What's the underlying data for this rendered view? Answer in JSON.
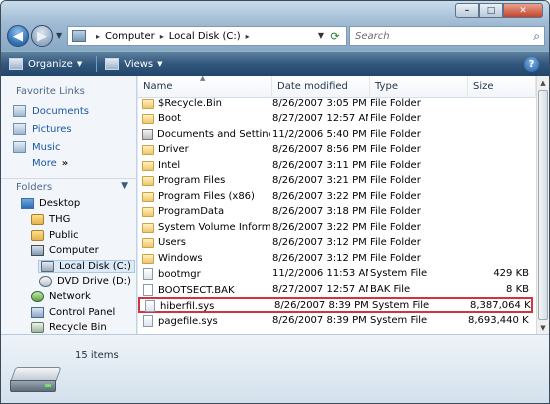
{
  "window": {
    "caption_buttons": {
      "minimize": "–",
      "maximize": "□",
      "close": "✕"
    }
  },
  "nav": {
    "back_icon": "arrow-left-icon",
    "forward_icon": "arrow-right-icon",
    "breadcrumb": [
      "Computer",
      "Local Disk (C:)"
    ],
    "search_placeholder": "Search"
  },
  "toolbar": {
    "organize_label": "Organize",
    "views_label": "Views",
    "help_label": "?"
  },
  "sidebar": {
    "favorites_header": "Favorite Links",
    "favorites": [
      {
        "label": "Documents",
        "icon": "documents-icon"
      },
      {
        "label": "Pictures",
        "icon": "pictures-icon"
      },
      {
        "label": "Music",
        "icon": "music-icon"
      }
    ],
    "more_label": "More",
    "more_arrow": "»",
    "folders_label": "Folders",
    "tree": [
      {
        "label": "Desktop",
        "icon": "desktop-icon"
      },
      {
        "label": "THG",
        "icon": "user-folder-icon"
      },
      {
        "label": "Public",
        "icon": "user-folder-icon"
      },
      {
        "label": "Computer",
        "icon": "computer-icon"
      },
      {
        "label": "Local Disk (C:)",
        "icon": "hard-drive-icon"
      },
      {
        "label": "DVD Drive (D:)",
        "icon": "dvd-drive-icon"
      },
      {
        "label": "Network",
        "icon": "network-icon"
      },
      {
        "label": "Control Panel",
        "icon": "control-panel-icon"
      },
      {
        "label": "Recycle Bin",
        "icon": "recycle-bin-icon"
      }
    ]
  },
  "columns": {
    "name": "Name",
    "date": "Date modified",
    "type": "Type",
    "size": "Size"
  },
  "files": [
    {
      "name": "$Recycle.Bin",
      "date": "8/26/2007 3:05 PM",
      "type": "File Folder",
      "size": "",
      "icon": "folder"
    },
    {
      "name": "Boot",
      "date": "8/27/2007 12:57 AM",
      "type": "File Folder",
      "size": "",
      "icon": "folder"
    },
    {
      "name": "Documents and Settings",
      "date": "11/2/2006 5:40 PM",
      "type": "File Folder",
      "size": "",
      "icon": "shortcut"
    },
    {
      "name": "Driver",
      "date": "8/26/2007 8:56 PM",
      "type": "File Folder",
      "size": "",
      "icon": "folder"
    },
    {
      "name": "Intel",
      "date": "8/26/2007 3:11 PM",
      "type": "File Folder",
      "size": "",
      "icon": "folder"
    },
    {
      "name": "Program Files",
      "date": "8/26/2007 3:21 PM",
      "type": "File Folder",
      "size": "",
      "icon": "folder"
    },
    {
      "name": "Program Files (x86)",
      "date": "8/26/2007 3:22 PM",
      "type": "File Folder",
      "size": "",
      "icon": "folder"
    },
    {
      "name": "ProgramData",
      "date": "8/26/2007 3:18 PM",
      "type": "File Folder",
      "size": "",
      "icon": "folder"
    },
    {
      "name": "System Volume Inform...",
      "date": "8/26/2007 3:22 PM",
      "type": "File Folder",
      "size": "",
      "icon": "folder"
    },
    {
      "name": "Users",
      "date": "8/26/2007 3:12 PM",
      "type": "File Folder",
      "size": "",
      "icon": "folder"
    },
    {
      "name": "Windows",
      "date": "8/26/2007 3:12 PM",
      "type": "File Folder",
      "size": "",
      "icon": "folder"
    },
    {
      "name": "bootmgr",
      "date": "11/2/2006 11:53 AM",
      "type": "System File",
      "size": "429 KB",
      "icon": "sysfile"
    },
    {
      "name": "BOOTSECT.BAK",
      "date": "8/27/2007 12:57 AM",
      "type": "BAK File",
      "size": "8 KB",
      "icon": "file"
    },
    {
      "name": "hiberfil.sys",
      "date": "8/26/2007 8:39 PM",
      "type": "System File",
      "size": "8,387,064 KB",
      "icon": "sysfile",
      "highlight": true
    },
    {
      "name": "pagefile.sys",
      "date": "8/26/2007 8:39 PM",
      "type": "System File",
      "size": "8,693,440 KB",
      "icon": "sysfile"
    }
  ],
  "details": {
    "items_count": "15 items",
    "icon": "hard-drive-icon"
  },
  "colors": {
    "highlight_border": "#d0343c",
    "link_blue": "#1b56a8",
    "toolbar_dark": "#22466b"
  }
}
